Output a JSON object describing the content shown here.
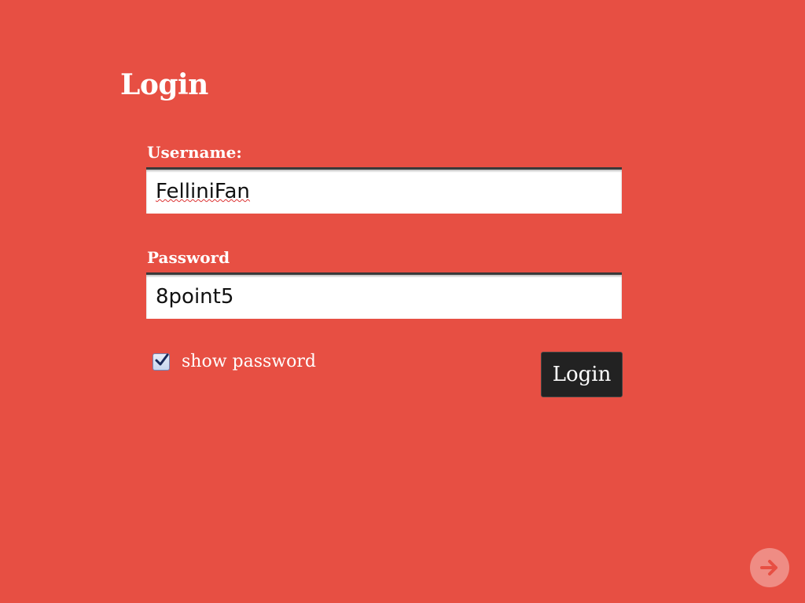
{
  "page": {
    "title": "Login"
  },
  "form": {
    "username_label": "Username:",
    "username_value": "FelliniFan",
    "password_label": "Password",
    "password_value": "8point5",
    "show_password_label": "show password",
    "show_password_checked": true,
    "submit_label": "Login"
  },
  "navigation": {
    "next_icon": "arrow-right-icon"
  },
  "colors": {
    "background": "#e74f43",
    "button": "#222222",
    "text": "#ffffff"
  }
}
